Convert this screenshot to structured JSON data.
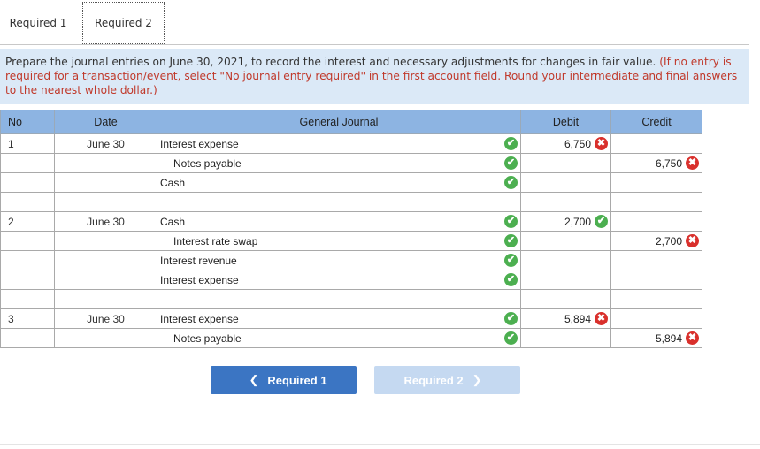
{
  "tabs": [
    {
      "label": "Required 1"
    },
    {
      "label": "Required 2"
    }
  ],
  "instructions": {
    "main": "Prepare the journal entries on June 30, 2021, to record the interest and necessary adjustments for changes in fair value.",
    "note": "(If no entry is required for a transaction/event, select \"No journal entry required\" in the first account field. Round your intermediate and final answers to the nearest whole dollar.)"
  },
  "table": {
    "headers": {
      "no": "No",
      "date": "Date",
      "journal": "General Journal",
      "debit": "Debit",
      "credit": "Credit"
    },
    "rows": [
      {
        "no": "1",
        "date": "June 30",
        "account": "Interest expense",
        "indent": false,
        "acct_status": "correct",
        "debit": "6,750",
        "debit_status": "incorrect",
        "credit": "",
        "credit_status": ""
      },
      {
        "no": "",
        "date": "",
        "account": "Notes payable",
        "indent": true,
        "acct_status": "correct",
        "debit": "",
        "debit_status": "",
        "credit": "6,750",
        "credit_status": "incorrect"
      },
      {
        "no": "",
        "date": "",
        "account": "Cash",
        "indent": false,
        "acct_status": "correct",
        "debit": "",
        "debit_status": "",
        "credit": "",
        "credit_status": ""
      },
      {
        "no": "",
        "date": "",
        "account": "",
        "indent": false,
        "acct_status": "",
        "debit": "",
        "debit_status": "",
        "credit": "",
        "credit_status": ""
      },
      {
        "no": "2",
        "date": "June 30",
        "account": "Cash",
        "indent": false,
        "acct_status": "correct",
        "debit": "2,700",
        "debit_status": "correct",
        "credit": "",
        "credit_status": ""
      },
      {
        "no": "",
        "date": "",
        "account": "Interest rate swap",
        "indent": true,
        "acct_status": "correct",
        "debit": "",
        "debit_status": "",
        "credit": "2,700",
        "credit_status": "incorrect"
      },
      {
        "no": "",
        "date": "",
        "account": "Interest revenue",
        "indent": false,
        "acct_status": "correct",
        "debit": "",
        "debit_status": "",
        "credit": "",
        "credit_status": ""
      },
      {
        "no": "",
        "date": "",
        "account": "Interest expense",
        "indent": false,
        "acct_status": "correct",
        "debit": "",
        "debit_status": "",
        "credit": "",
        "credit_status": ""
      },
      {
        "no": "",
        "date": "",
        "account": "",
        "indent": false,
        "acct_status": "",
        "debit": "",
        "debit_status": "",
        "credit": "",
        "credit_status": ""
      },
      {
        "no": "3",
        "date": "June 30",
        "account": "Interest expense",
        "indent": false,
        "acct_status": "correct",
        "debit": "5,894",
        "debit_status": "incorrect",
        "credit": "",
        "credit_status": ""
      },
      {
        "no": "",
        "date": "",
        "account": "Notes payable",
        "indent": true,
        "acct_status": "correct",
        "debit": "",
        "debit_status": "",
        "credit": "5,894",
        "credit_status": "incorrect"
      }
    ]
  },
  "nav": {
    "prev_label": "Required 1",
    "next_label": "Required 2"
  },
  "icons": {
    "correct": "check-circle-icon",
    "incorrect": "x-circle-icon",
    "prev": "chevron-left-icon",
    "next": "chevron-right-icon"
  },
  "colors": {
    "header_bg": "#8db4e2",
    "instructions_bg": "#dbe9f7",
    "correct": "#4caf50",
    "incorrect": "#d9302c",
    "prev_button": "#3b75c3",
    "next_button": "#c5d9f1",
    "note_text": "#c0392b"
  }
}
